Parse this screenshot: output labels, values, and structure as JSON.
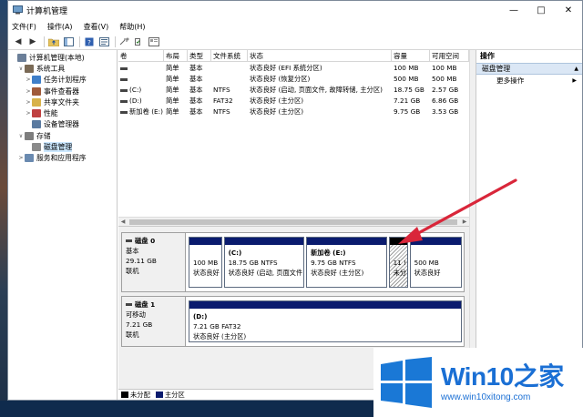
{
  "window": {
    "title": "计算机管理",
    "controls": [
      "—",
      "□",
      "✕"
    ]
  },
  "menu": [
    "文件(F)",
    "操作(A)",
    "查看(V)",
    "帮助(H)"
  ],
  "tree": [
    {
      "label": "计算机管理(本地)",
      "indent": 0,
      "caret": "",
      "icon": "computer-icon",
      "color": "#6b7f99"
    },
    {
      "label": "系统工具",
      "indent": 1,
      "caret": "∨",
      "icon": "tools-icon",
      "color": "#7a6a56"
    },
    {
      "label": "任务计划程序",
      "indent": 2,
      "caret": ">",
      "icon": "clock-icon",
      "color": "#3f7fc9"
    },
    {
      "label": "事件查看器",
      "indent": 2,
      "caret": ">",
      "icon": "event-icon",
      "color": "#a05a3a"
    },
    {
      "label": "共享文件夹",
      "indent": 2,
      "caret": ">",
      "icon": "folder-icon",
      "color": "#d8b24a"
    },
    {
      "label": "性能",
      "indent": 2,
      "caret": ">",
      "icon": "performance-icon",
      "color": "#c04040"
    },
    {
      "label": "设备管理器",
      "indent": 2,
      "caret": "",
      "icon": "device-icon",
      "color": "#5a7aa0"
    },
    {
      "label": "存储",
      "indent": 1,
      "caret": "∨",
      "icon": "storage-icon",
      "color": "#7d7d7d"
    },
    {
      "label": "磁盘管理",
      "indent": 2,
      "caret": "",
      "icon": "disk-icon",
      "color": "#8a8a8a",
      "selected": true
    },
    {
      "label": "服务和应用程序",
      "indent": 1,
      "caret": ">",
      "icon": "services-icon",
      "color": "#6a8ab0"
    }
  ],
  "volume_table": {
    "headers": [
      "卷",
      "布局",
      "类型",
      "文件系统",
      "状态",
      "容量",
      "可用空间"
    ],
    "rows": [
      [
        "",
        "简单",
        "基本",
        "",
        "状态良好 (EFI 系统分区)",
        "100 MB",
        "100 MB"
      ],
      [
        "",
        "简单",
        "基本",
        "",
        "状态良好 (恢复分区)",
        "500 MB",
        "500 MB"
      ],
      [
        "(C:)",
        "简单",
        "基本",
        "NTFS",
        "状态良好 (启动, 页面文件, 故障转储, 主分区)",
        "18.75 GB",
        "2.57 GB"
      ],
      [
        "(D:)",
        "简单",
        "基本",
        "FAT32",
        "状态良好 (主分区)",
        "7.21 GB",
        "6.86 GB"
      ],
      [
        "新加卷 (E:)",
        "简单",
        "基本",
        "NTFS",
        "状态良好 (主分区)",
        "9.75 GB",
        "3.53 GB"
      ]
    ]
  },
  "disks": [
    {
      "name": "磁盘 0",
      "type": "基本",
      "size": "29.11 GB",
      "status": "联机",
      "partitions": [
        {
          "title": "",
          "line1": "100 MB",
          "line2": "状态良好",
          "kind": "primary",
          "share": 0.1
        },
        {
          "title": "(C:)",
          "line1": "18.75 GB NTFS",
          "line2": "状态良好 (启动, 页面文件",
          "kind": "primary",
          "share": 0.25
        },
        {
          "title": "新加卷 (E:)",
          "line1": "9.75 GB NTFS",
          "line2": "状态良好 (主分区)",
          "kind": "primary",
          "share": 0.25
        },
        {
          "title": "",
          "line1": "11 !",
          "line2": "未分",
          "kind": "unallocated",
          "share": 0.055
        },
        {
          "title": "",
          "line1": "500 MB",
          "line2": "状态良好",
          "kind": "primary",
          "share": 0.16
        }
      ]
    },
    {
      "name": "磁盘 1",
      "type": "可移动",
      "size": "7.21 GB",
      "status": "联机",
      "partitions": [
        {
          "title": "(D:)",
          "line1": "7.21 GB FAT32",
          "line2": "状态良好 (主分区)",
          "kind": "primary",
          "share": 1
        }
      ]
    }
  ],
  "legend": [
    {
      "label": "未分配",
      "color": "#000000"
    },
    {
      "label": "主分区",
      "color": "#0a1b6e"
    }
  ],
  "actions": {
    "header": "操作",
    "section": "磁盘管理",
    "items": [
      "更多操作"
    ]
  },
  "watermark": {
    "brand": "Win10",
    "brand_zh": "之家",
    "url": "www.win10xitong.com"
  },
  "colors": {
    "primary_partition": "#0a1b6e",
    "unallocated": "#000000",
    "annotation_arrow": "#d9263a",
    "brand": "#1a6fd4"
  }
}
